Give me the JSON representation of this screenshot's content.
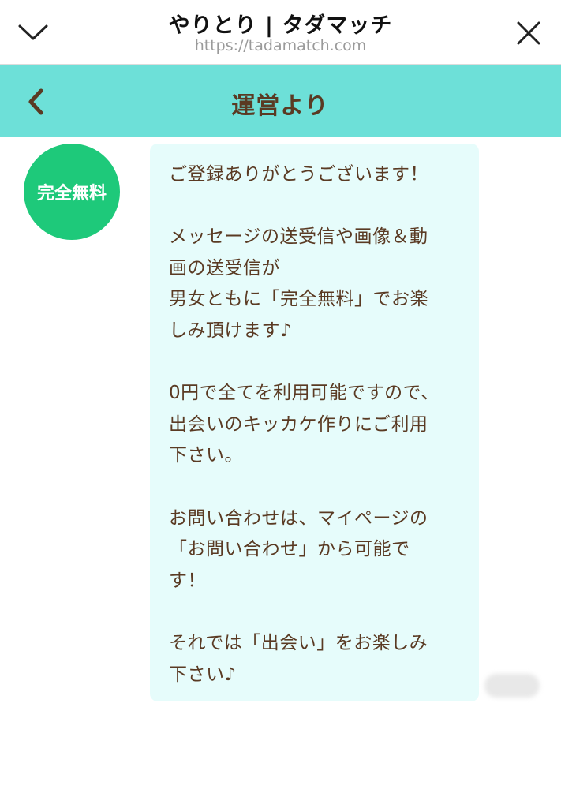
{
  "browser": {
    "title": "やりとり | タダマッチ",
    "url": "https://tadamatch.com"
  },
  "header": {
    "title": "運営より"
  },
  "avatar": {
    "label": "完全無料"
  },
  "message": {
    "lines": [
      "ご登録ありがとうございます！",
      "",
      "メッセージの送受信や画像＆動",
      "画の送受信が",
      "男女ともに「完全無料」でお楽",
      "しみ頂けます♪",
      "",
      "0円で全てを利用可能ですので、",
      "出会いのキッカケ作りにご利用",
      "下さい。",
      "",
      "お問い合わせは、マイページの",
      "「お問い合わせ」から可能で",
      "す！",
      "",
      "それでは「出会い」をお楽しみ",
      "下さい♪"
    ]
  },
  "icons": {
    "collapse": "chevron-down-icon",
    "close": "close-icon",
    "back": "chevron-left-icon"
  },
  "colors": {
    "header_bg": "#6de0d8",
    "header_text": "#5a3a23",
    "avatar_bg": "#1ec97a",
    "bubble_bg": "#e6fcfb",
    "message_text": "#5a3a23"
  }
}
